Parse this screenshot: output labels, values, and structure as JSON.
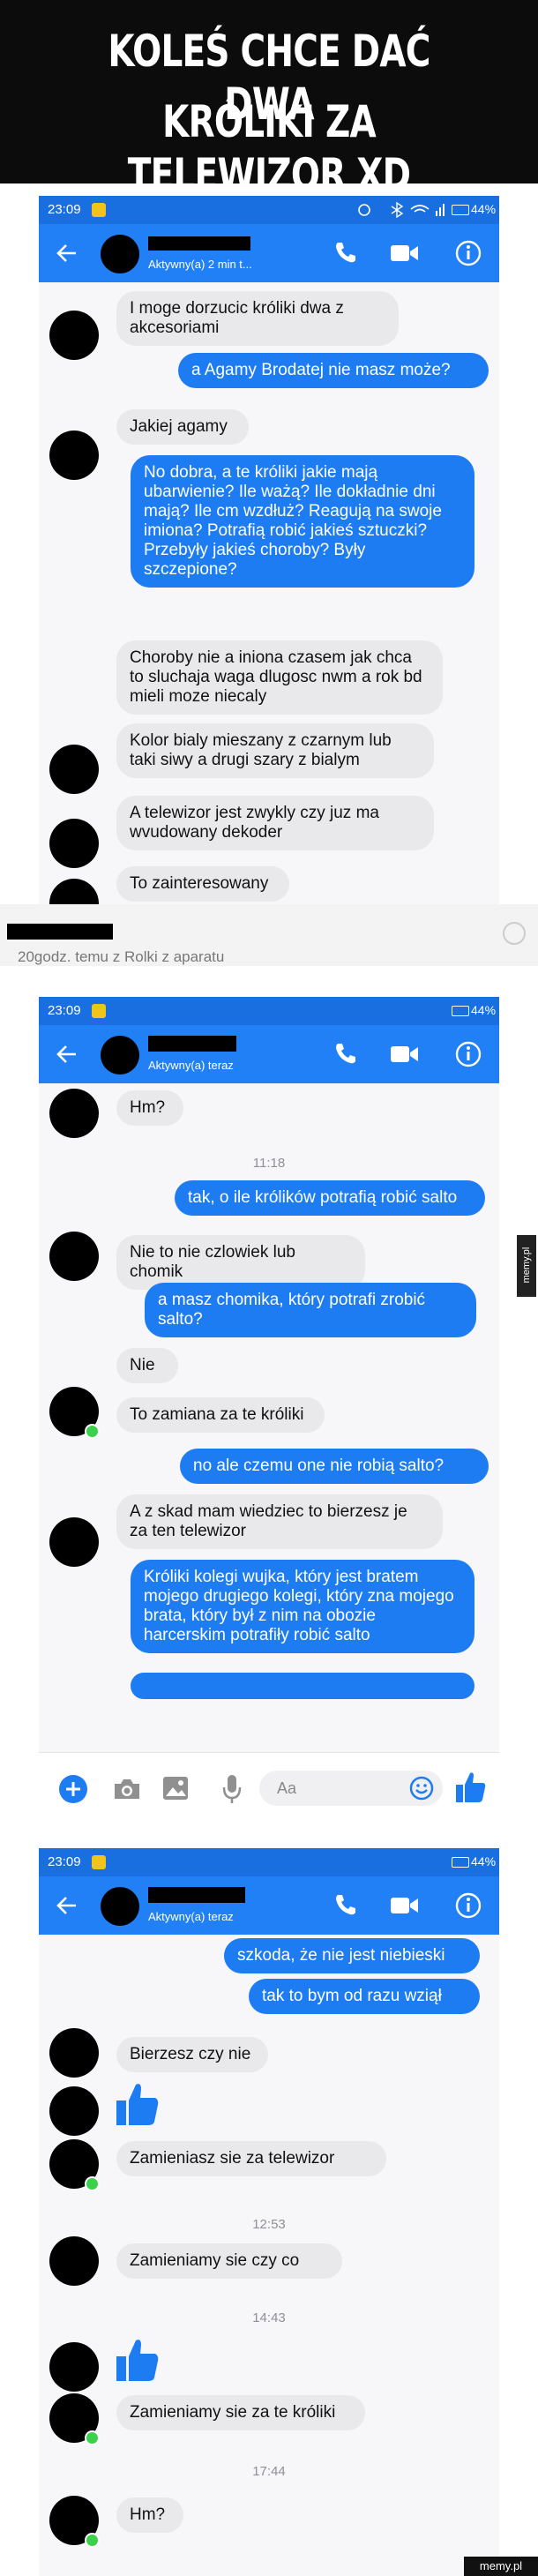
{
  "header": {
    "line1": "KOLEŚ CHCE DAĆ DWA",
    "line2": "KRÓLIKI ZA TELEWIZOR XD"
  },
  "shot1": {
    "time": "23:09",
    "battery": "44%",
    "contact_status": "Aktywny(a) 2 min t...",
    "messages": [
      {
        "side": "in",
        "text": "I moge  dorzucic króliki dwa z akcesoriami"
      },
      {
        "side": "out",
        "text": "a Agamy Brodatej nie masz może?"
      },
      {
        "side": "in",
        "text": "Jakiej agamy"
      },
      {
        "side": "out",
        "text": "No dobra, a te króliki jakie mają ubarwienie? Ile ważą? Ile dokładnie dni mają? Ile cm wzdłuż? Reagują na swoje imiona? Potrafią robić jakieś sztuczki? Przebyły jakieś choroby? Były szczepione?"
      },
      {
        "side": "in",
        "text": "Choroby nie a iniona czasem jak chca to sluchaja waga dlugosc nwm a rok bd mieli moze niecaly"
      },
      {
        "side": "in",
        "text": "Kolor bialy mieszany z czarnym lub taki siwy a drugi szary z bialym"
      },
      {
        "side": "in",
        "text": "A telewizor jest zwykly czy juz ma wvudowany dekoder"
      },
      {
        "side": "in",
        "text": "To zainteresowany"
      }
    ]
  },
  "post_meta": "20godz. temu z Rolki z aparatu",
  "shot2": {
    "time": "23:09",
    "battery": "44%",
    "contact_status": "Aktywny(a) teraz",
    "input_placeholder": "Aa",
    "messages": [
      {
        "side": "in",
        "text": "Hm?"
      },
      {
        "side": "ts",
        "text": "11:18"
      },
      {
        "side": "out",
        "text": "tak, o ile królików potrafią robić salto"
      },
      {
        "side": "in",
        "text": "Nie to nie czlowiek lub chomik"
      },
      {
        "side": "out",
        "text": "a masz chomika, który potrafi zrobić salto?"
      },
      {
        "side": "in",
        "text": "Nie"
      },
      {
        "side": "in",
        "text": "To zamiana za te króliki"
      },
      {
        "side": "out",
        "text": "no ale czemu one nie robią salto?"
      },
      {
        "side": "in",
        "text": "A z skad mam wiedziec to bierzesz je za ten telewizor"
      },
      {
        "side": "out",
        "text": "Króliki kolegi wujka, który jest bratem mojego drugiego kolegi, który zna mojego brata, który był z nim na obozie harcerskim potrafiły robić salto"
      }
    ]
  },
  "shot3": {
    "time": "23:09",
    "battery": "44%",
    "contact_status": "Aktywny(a) teraz",
    "messages": [
      {
        "side": "out",
        "text": "szkoda, że nie jest niebieski"
      },
      {
        "side": "out",
        "text": "tak to bym od razu wziął"
      },
      {
        "side": "in",
        "text": "Bierzesz czy nie"
      },
      {
        "side": "in",
        "text": "Zamieniasz sie za telewizor"
      },
      {
        "side": "ts",
        "text": "12:53"
      },
      {
        "side": "in",
        "text": "Zamieniamy sie czy co"
      },
      {
        "side": "ts",
        "text": "14:43"
      },
      {
        "side": "in",
        "text": "Zamieniamy sie za te króliki"
      },
      {
        "side": "ts",
        "text": "17:44"
      },
      {
        "side": "in",
        "text": "Hm?"
      }
    ]
  },
  "watermark_side": "memy.pl",
  "watermark_corner": "memy.pl",
  "colors": {
    "messenger_blue": "#2180f5",
    "status_bar": "#1a6fe0",
    "bubble_in": "#e9e9ec",
    "online": "#3bd14a"
  },
  "icons": [
    "back-arrow-icon",
    "phone-icon",
    "video-icon",
    "info-icon",
    "plus-icon",
    "camera-icon",
    "gallery-icon",
    "mic-icon",
    "emoji-icon",
    "thumbs-up-icon"
  ]
}
